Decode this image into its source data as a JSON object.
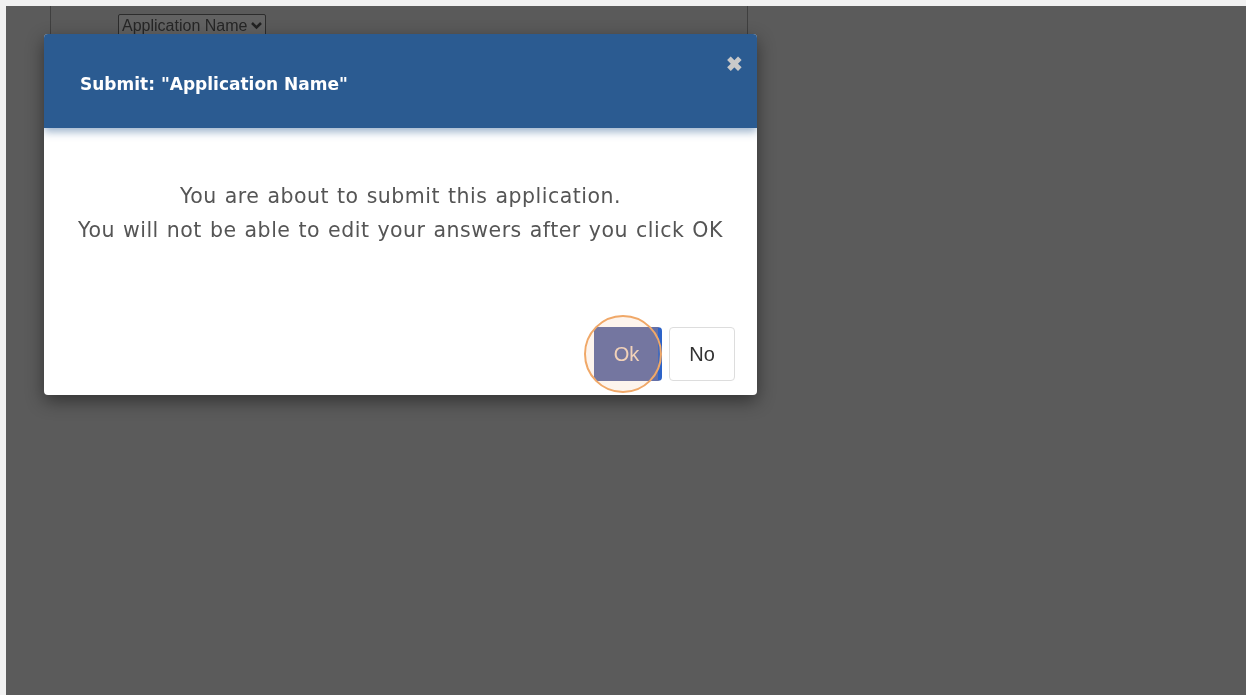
{
  "background_page": {
    "select": {
      "value": "Application Name"
    }
  },
  "dialog": {
    "title": "Submit: \"Application Name\"",
    "close": "✖",
    "message": [
      "You are about to submit this application.",
      "You will not be able to edit your answers after you click OK"
    ],
    "buttons": [
      {
        "label": "Ok",
        "kind": "primary",
        "highlighted": true
      },
      {
        "label": "No",
        "kind": "default",
        "highlighted": false
      }
    ]
  }
}
